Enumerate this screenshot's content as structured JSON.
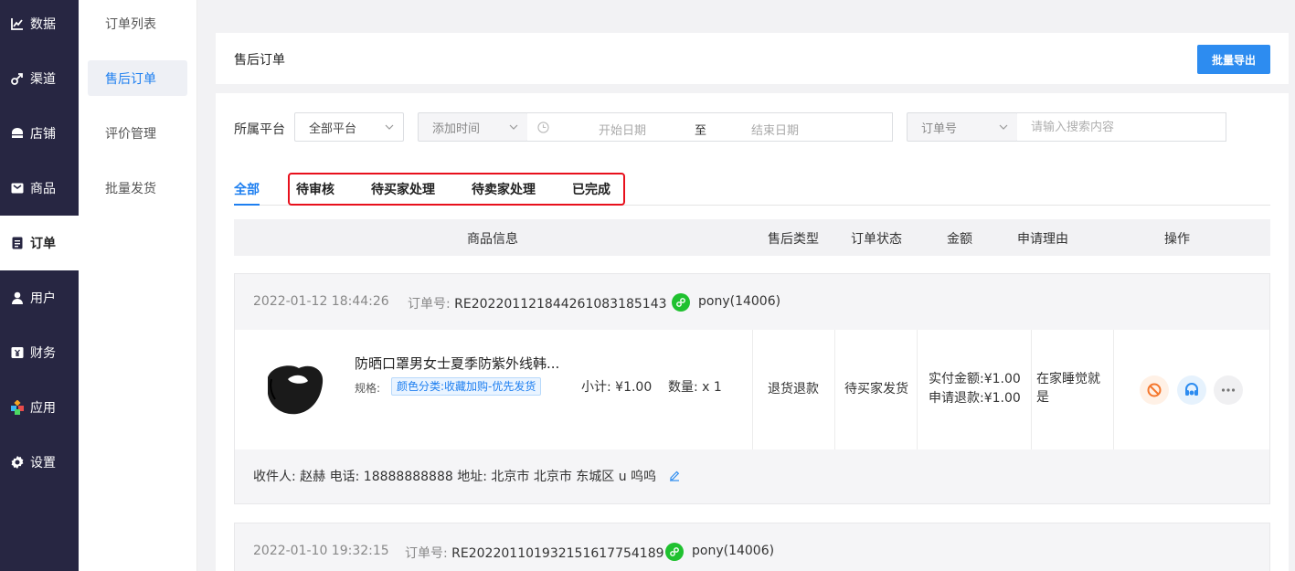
{
  "nav_primary": [
    {
      "label": "数据",
      "icon": "chart-line-icon"
    },
    {
      "label": "渠道",
      "icon": "link-icon"
    },
    {
      "label": "店铺",
      "icon": "store-icon"
    },
    {
      "label": "商品",
      "icon": "box-icon"
    },
    {
      "label": "订单",
      "icon": "clipboard-icon",
      "active": true
    },
    {
      "label": "用户",
      "icon": "user-icon"
    },
    {
      "label": "财务",
      "icon": "yen-icon"
    },
    {
      "label": "应用",
      "icon": "apps-icon"
    },
    {
      "label": "设置",
      "icon": "gear-icon"
    }
  ],
  "nav_secondary": [
    {
      "label": "订单列表"
    },
    {
      "label": "售后订单",
      "active": true
    },
    {
      "label": "评价管理"
    },
    {
      "label": "批量发货"
    }
  ],
  "header": {
    "title": "售后订单",
    "export_label": "批量导出"
  },
  "filters": {
    "platform_label": "所属平台",
    "platform_value": "全部平台",
    "time_type": "添加时间",
    "start_placeholder": "开始日期",
    "to_label": "至",
    "end_placeholder": "结束日期",
    "search_type": "订单号",
    "search_placeholder": "请输入搜索内容"
  },
  "tabs": [
    "全部",
    "待审核",
    "待买家处理",
    "待卖家处理",
    "已完成"
  ],
  "table_headers": [
    "商品信息",
    "售后类型",
    "订单状态",
    "金额",
    "申请理由",
    "操作"
  ],
  "orders": [
    {
      "time": "2022-01-12 18:44:26",
      "order_no_label": "订单号:",
      "order_no": "RE2022011218442610831851​43",
      "buyer": "pony(14006)",
      "product_title": "防晒口罩男女士夏季防紫外线韩...",
      "spec_label": "规格:",
      "spec_value": "颜色分类:收藏加购-优先发货",
      "subtotal": "小计: ¥1.00",
      "qty": "数量: x 1",
      "aftersale_type": "退货退款",
      "status": "待买家发货",
      "paid": "实付金额:¥1.00",
      "refund": "申请退款:¥1.00",
      "reason": "在家睡觉就是",
      "address": "收件人: 赵赫 电话: 18888888888 地址: 北京市 北京市 东城区 u 呜呜"
    },
    {
      "time": "2022-01-10 19:32:15",
      "order_no_label": "订单号:",
      "order_no": "RE2022011019321516177541​89",
      "buyer": "pony(14006)"
    }
  ],
  "colors": {
    "sidebar": "#272642",
    "accent": "#1e7ff0",
    "button": "#2d8cf0",
    "highlight": "#e8101c",
    "wechat": "#1fc12f"
  }
}
